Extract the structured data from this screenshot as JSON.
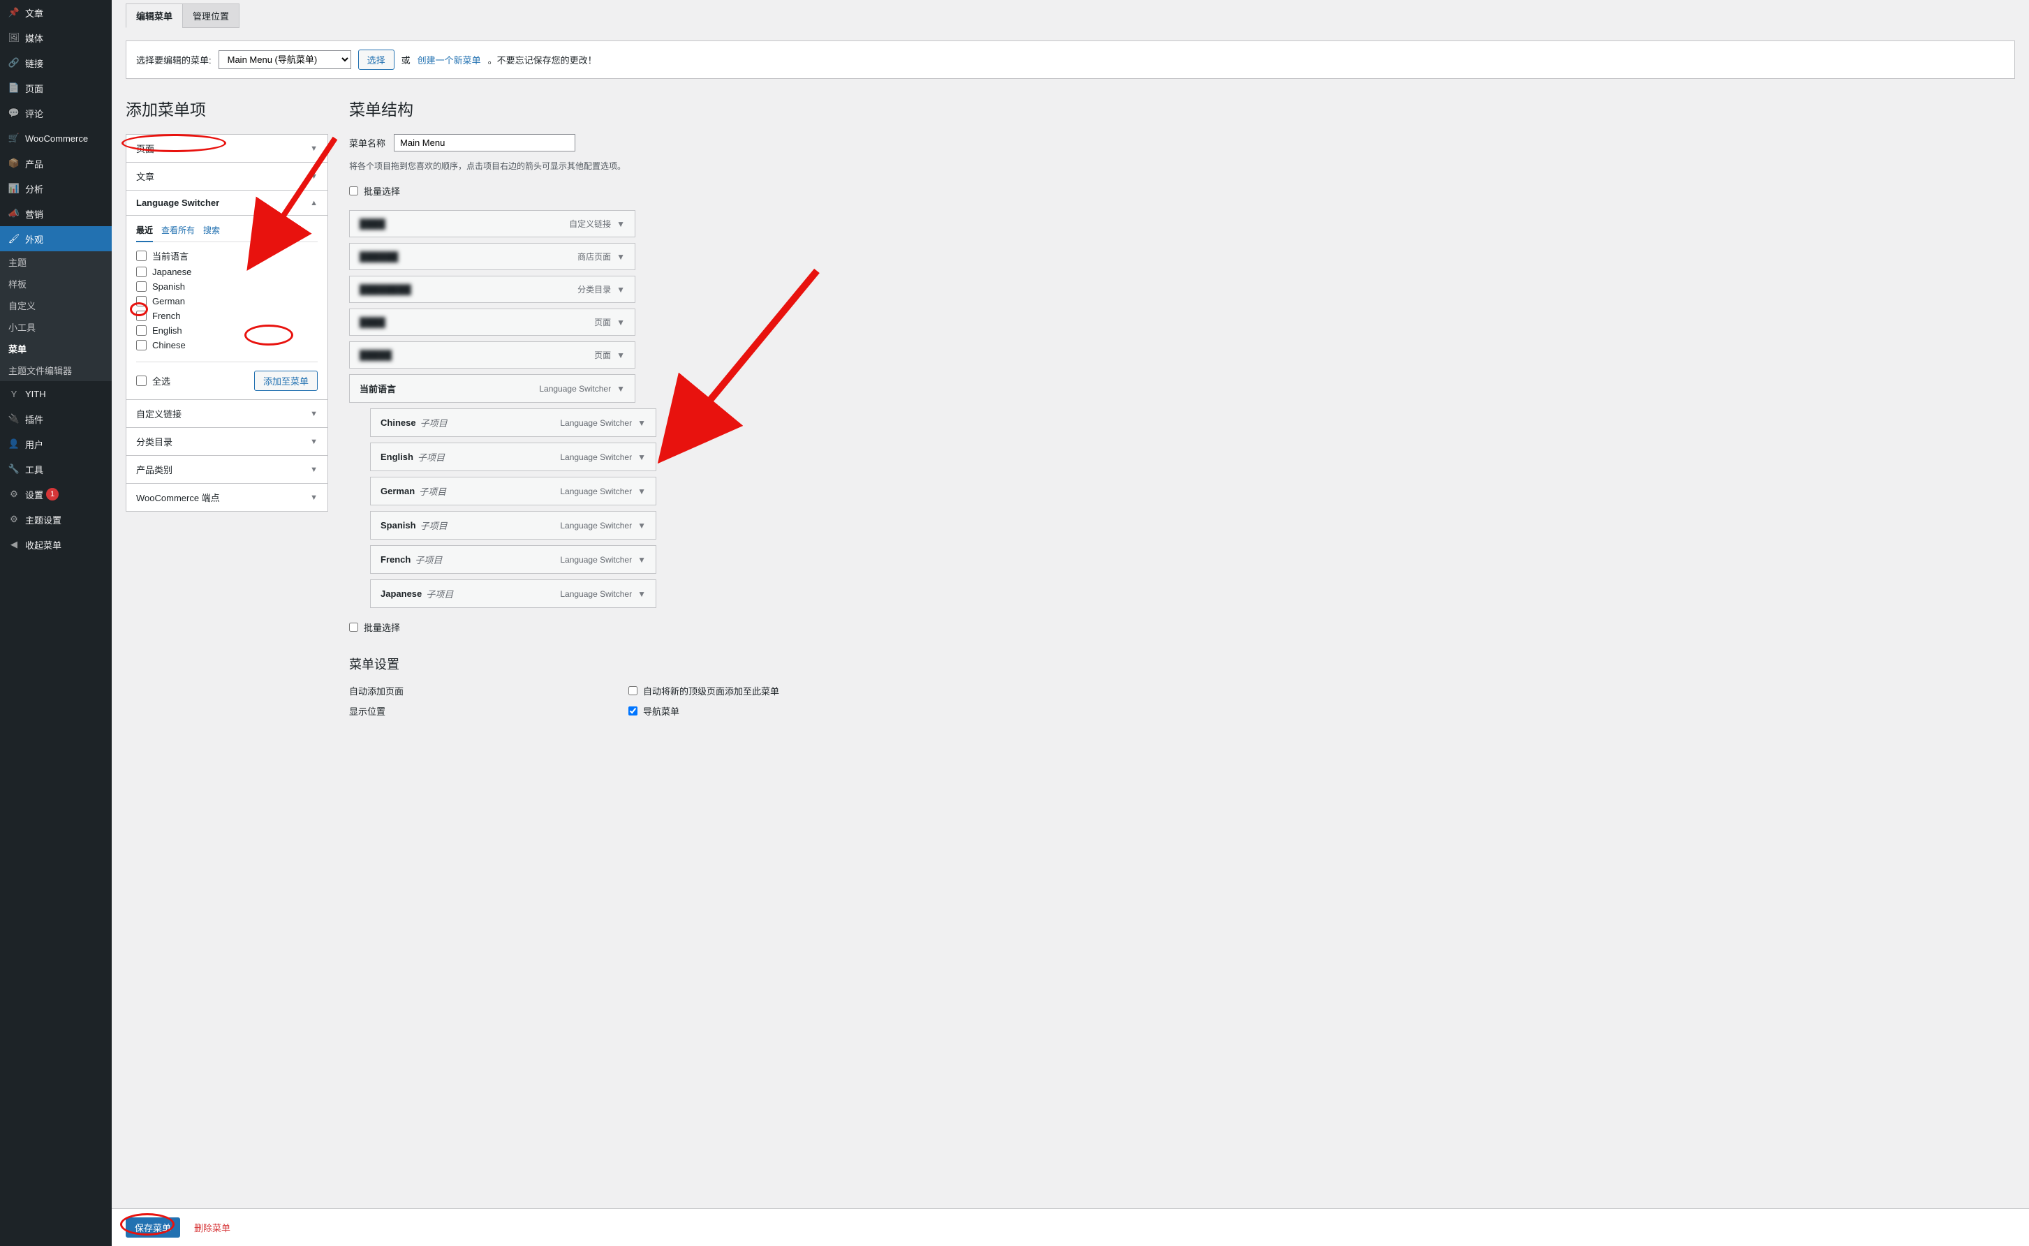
{
  "sidebar": {
    "items": [
      {
        "label": "文章",
        "icon": "📌"
      },
      {
        "label": "媒体",
        "icon": "🖼"
      },
      {
        "label": "链接",
        "icon": "🔗"
      },
      {
        "label": "页面",
        "icon": "📄"
      },
      {
        "label": "评论",
        "icon": "💬"
      },
      {
        "label": "WooCommerce",
        "icon": "🛒"
      },
      {
        "label": "产品",
        "icon": "📦"
      },
      {
        "label": "分析",
        "icon": "📊"
      },
      {
        "label": "营销",
        "icon": "📣"
      },
      {
        "label": "外观",
        "icon": "🖌",
        "active": true
      },
      {
        "label": "YITH",
        "icon": "Y"
      },
      {
        "label": "插件",
        "icon": "🔌"
      },
      {
        "label": "用户",
        "icon": "👤"
      },
      {
        "label": "工具",
        "icon": "🔧"
      },
      {
        "label": "设置",
        "icon": "⚙",
        "badge": "1"
      },
      {
        "label": "主题设置",
        "icon": "⚙"
      },
      {
        "label": "收起菜单",
        "icon": "◀"
      }
    ],
    "sub": [
      {
        "label": "主题"
      },
      {
        "label": "样板"
      },
      {
        "label": "自定义"
      },
      {
        "label": "小工具"
      },
      {
        "label": "菜单",
        "active": true
      },
      {
        "label": "主题文件编辑器"
      }
    ]
  },
  "tabs": [
    {
      "label": "编辑菜单",
      "active": true
    },
    {
      "label": "管理位置"
    }
  ],
  "selectBar": {
    "label": "选择要编辑的菜单:",
    "value": "Main Menu (导航菜单)",
    "button": "选择",
    "orText": "或",
    "createLink": "创建一个新菜单",
    "note": "。不要忘记保存您的更改！"
  },
  "left": {
    "title": "添加菜单项",
    "accordion": [
      {
        "label": "页面"
      },
      {
        "label": "文章"
      },
      {
        "label": "Language Switcher",
        "expanded": true
      },
      {
        "label": "自定义链接"
      },
      {
        "label": "分类目录"
      },
      {
        "label": "产品类别"
      },
      {
        "label": "WooCommerce 端点"
      }
    ],
    "subTabs": [
      {
        "label": "最近",
        "active": true
      },
      {
        "label": "查看所有"
      },
      {
        "label": "搜索"
      }
    ],
    "checks": [
      {
        "label": "当前语言"
      },
      {
        "label": "Japanese"
      },
      {
        "label": "Spanish"
      },
      {
        "label": "German"
      },
      {
        "label": "French"
      },
      {
        "label": "English"
      },
      {
        "label": "Chinese"
      }
    ],
    "selectAll": "全选",
    "addButton": "添加至菜单"
  },
  "right": {
    "title": "菜单结构",
    "nameLabel": "菜单名称",
    "nameValue": "Main Menu",
    "hint": "将各个项目拖到您喜欢的顺序，点击项目右边的箭头可显示其他配置选项。",
    "bulkLabel": "批量选择",
    "items": [
      {
        "title": "████",
        "type": "自定义链接",
        "blur": true
      },
      {
        "title": "██████",
        "type": "商店页面",
        "blur": true
      },
      {
        "title": "████████",
        "type": "分类目录",
        "blur": true
      },
      {
        "title": "████",
        "type": "页面",
        "blur": true
      },
      {
        "title": "█████",
        "type": "页面",
        "blur": true
      },
      {
        "title": "当前语言",
        "type": "Language Switcher"
      },
      {
        "title": "Chinese",
        "sub": "子项目",
        "type": "Language Switcher",
        "indent": true
      },
      {
        "title": "English",
        "sub": "子项目",
        "type": "Language Switcher",
        "indent": true
      },
      {
        "title": "German",
        "sub": "子项目",
        "type": "Language Switcher",
        "indent": true
      },
      {
        "title": "Spanish",
        "sub": "子项目",
        "type": "Language Switcher",
        "indent": true
      },
      {
        "title": "French",
        "sub": "子项目",
        "type": "Language Switcher",
        "indent": true
      },
      {
        "title": "Japanese",
        "sub": "子项目",
        "type": "Language Switcher",
        "indent": true
      }
    ],
    "bulkLabel2": "批量选择",
    "settingsTitle": "菜单设置",
    "autoAdd": {
      "label": "自动添加页面",
      "check": "自动将新的顶级页面添加至此菜单"
    },
    "position": {
      "label": "显示位置",
      "check": "导航菜单"
    }
  },
  "saveBar": {
    "save": "保存菜单",
    "delete": "删除菜单"
  }
}
